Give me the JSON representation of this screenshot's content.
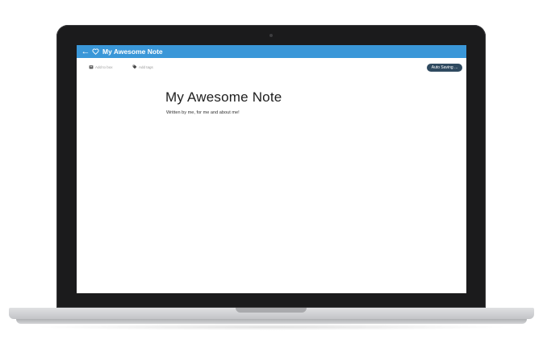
{
  "app": {
    "title": "My Awesome Note"
  },
  "toolbar": {
    "add_to_box": "Add to box",
    "add_tags": "Add tags",
    "status": "Auto Saving ..."
  },
  "note": {
    "title": "My Awesome Note",
    "subtitle": "Written by me, for me and about me!"
  },
  "icons": {
    "back": "arrow-left-icon",
    "favorite": "heart-outline-icon",
    "box": "box-icon",
    "tag": "tag-icon"
  },
  "colors": {
    "titlebar": "#3a97d8",
    "status_badge": "#2f4a60"
  }
}
